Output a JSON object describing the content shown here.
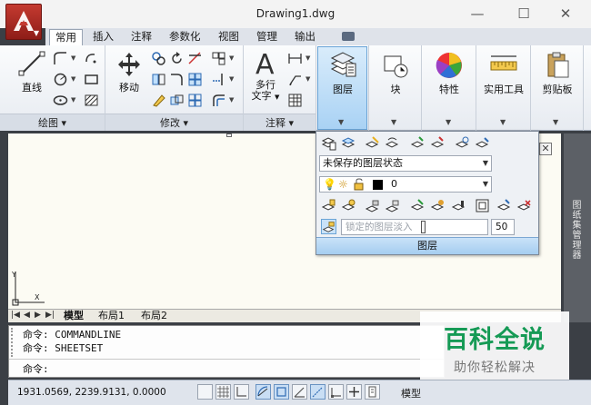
{
  "window": {
    "title": "Drawing1.dwg",
    "minimize_glyph": "—",
    "maximize_glyph": "☐",
    "close_glyph": "✕"
  },
  "ribbon": {
    "tabs": [
      {
        "label": "常用",
        "active": true
      },
      {
        "label": "插入"
      },
      {
        "label": "注释"
      },
      {
        "label": "参数化"
      },
      {
        "label": "视图"
      },
      {
        "label": "管理"
      },
      {
        "label": "输出"
      }
    ],
    "panels": {
      "draw": {
        "title": "绘图",
        "line_label": "直线"
      },
      "modify": {
        "title": "修改",
        "move_label": "移动"
      },
      "annotation": {
        "title": "注释",
        "mtext_label_1": "多行",
        "mtext_label_2": "文字"
      },
      "layers": {
        "label": "图层"
      },
      "block": {
        "label": "块"
      },
      "properties": {
        "label": "特性"
      },
      "utilities": {
        "label": "实用工具"
      },
      "clipboard": {
        "label": "剪贴板"
      }
    }
  },
  "layer_panel": {
    "state_select": "未保存的图层状态",
    "current_layer": "0",
    "input_placeholder": "锁定的图层淡入",
    "input_value": "50",
    "footer": "图层"
  },
  "canvas": {
    "ucs_x": "X",
    "ucs_y": "Y",
    "close_glyph": "✕"
  },
  "side_palette": {
    "label": "图纸集管理器"
  },
  "layout_tabs": [
    {
      "label": "模型",
      "active": true
    },
    {
      "label": "布局1"
    },
    {
      "label": "布局2"
    }
  ],
  "command": {
    "history": [
      "命令: COMMANDLINE",
      "命令: SHEETSET"
    ],
    "prompt": "命令:"
  },
  "status_bar": {
    "coordinates": "1931.0569, 2239.9131, 0.0000",
    "model_label": "模型"
  },
  "watermark": {
    "title": "百科全说",
    "subtitle": "助你轻松解决"
  },
  "colors": {
    "app_red": "#c43a30",
    "canvas_bg": "#fcfbf3",
    "highlight_blue": "#a9d2f4",
    "watermark_green": "#159a55"
  }
}
